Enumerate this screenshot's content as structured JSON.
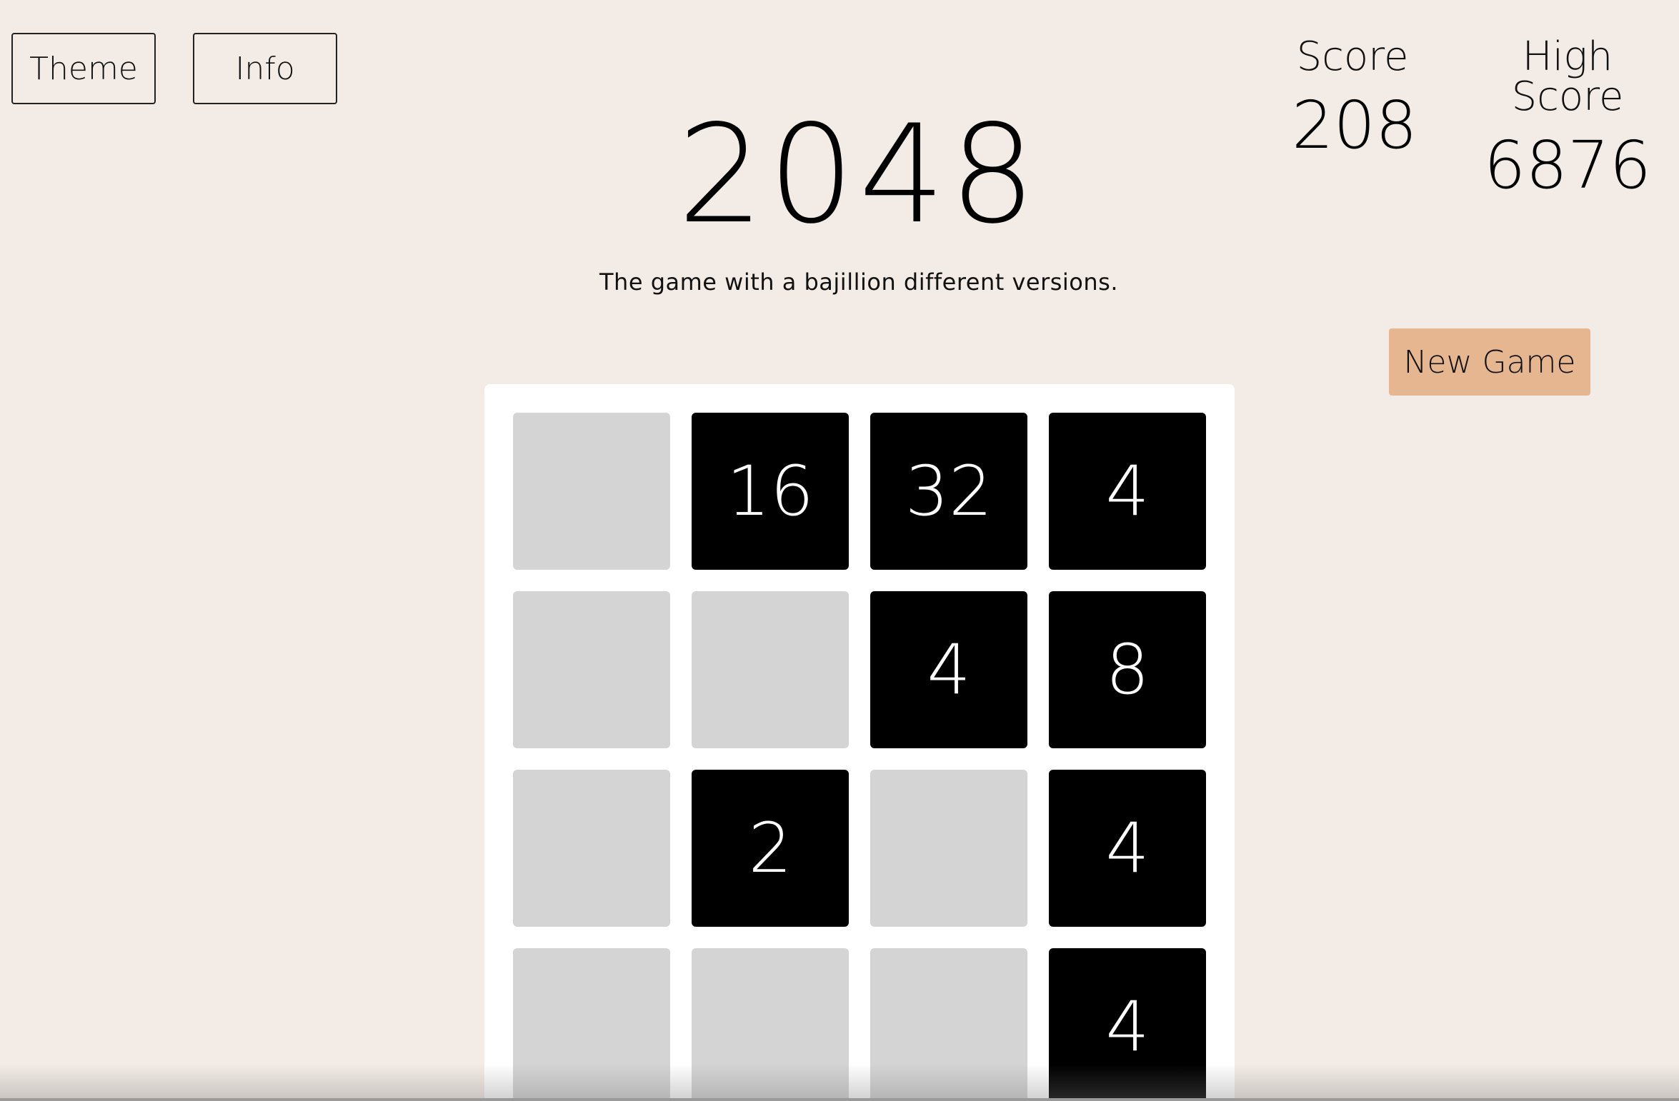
{
  "toolbar": {
    "theme_label": "Theme",
    "info_label": "Info"
  },
  "header": {
    "title": "2048",
    "subtitle": "The game with a bajillion different versions."
  },
  "scores": {
    "score_label": "Score",
    "score_value": "208",
    "high_score_label": "High Score",
    "high_score_value": "6876"
  },
  "actions": {
    "new_game_label": "New Game"
  },
  "board": {
    "rows": [
      [
        "",
        "16",
        "32",
        "4"
      ],
      [
        "",
        "",
        "4",
        "8"
      ],
      [
        "",
        "2",
        "",
        "4"
      ],
      [
        "",
        "",
        "",
        "4"
      ]
    ]
  },
  "colors": {
    "background": "#f3ece6",
    "tile_filled": "#000000",
    "tile_empty": "#d4d4d4",
    "new_game_button": "#e6b690"
  }
}
